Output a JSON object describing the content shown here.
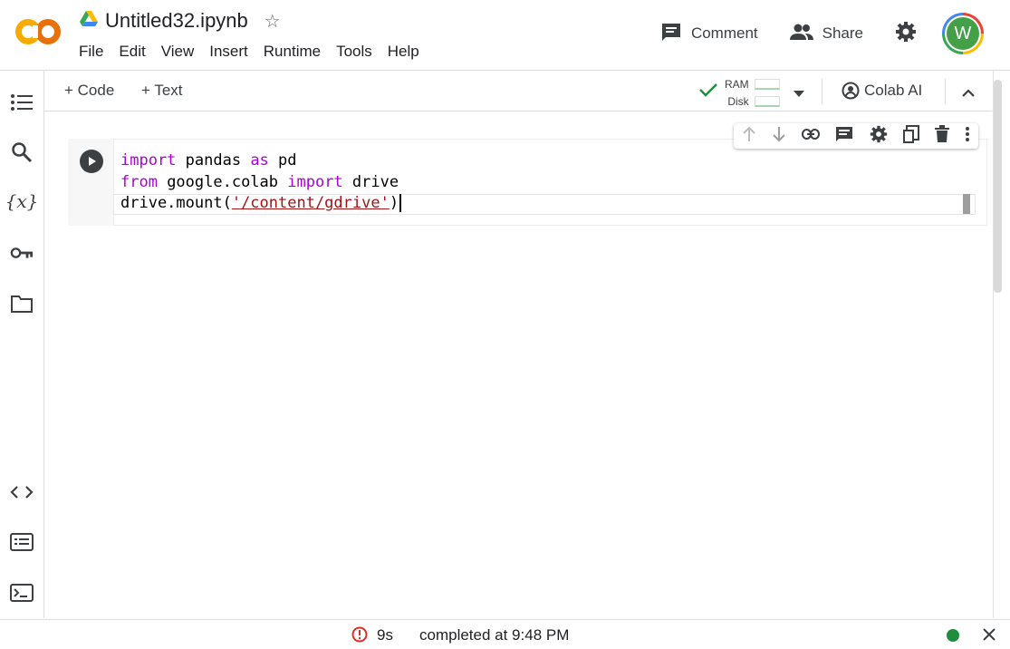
{
  "header": {
    "notebook_title": "Untitled32.ipynb",
    "logo_text": "CO",
    "menu": [
      "File",
      "Edit",
      "View",
      "Insert",
      "Runtime",
      "Tools",
      "Help"
    ],
    "comment_label": "Comment",
    "share_label": "Share",
    "avatar_letter": "W"
  },
  "toolbar": {
    "add_code": "+ Code",
    "add_text": "+ Text",
    "ram_label": "RAM",
    "disk_label": "Disk",
    "colab_ai": "Colab AI"
  },
  "sidebar": {
    "icons": [
      "toc-icon",
      "search-icon",
      "variables-icon",
      "key-icon",
      "folder-icon",
      "code-snippets-icon",
      "command-palette-icon",
      "terminal-icon"
    ],
    "variables_glyph": "{x}"
  },
  "cell": {
    "lines": [
      {
        "t1": "import",
        "t2": " pandas ",
        "t3": "as",
        "t4": " pd"
      },
      {
        "t1": "from",
        "t2": " google.colab ",
        "t3": "import",
        "t4": " drive"
      }
    ],
    "line3_prefix": "drive.mount(",
    "line3_string": "'/content/gdrive'",
    "line3_suffix": ")"
  },
  "status": {
    "duration": "9s",
    "message": "completed at 9:48 PM"
  },
  "colors": {
    "accent_orange": "#f9ab00",
    "keyword": "#af00db",
    "string": "#a31515",
    "connected_green": "#1e8e3e",
    "error_red": "#d93025"
  }
}
